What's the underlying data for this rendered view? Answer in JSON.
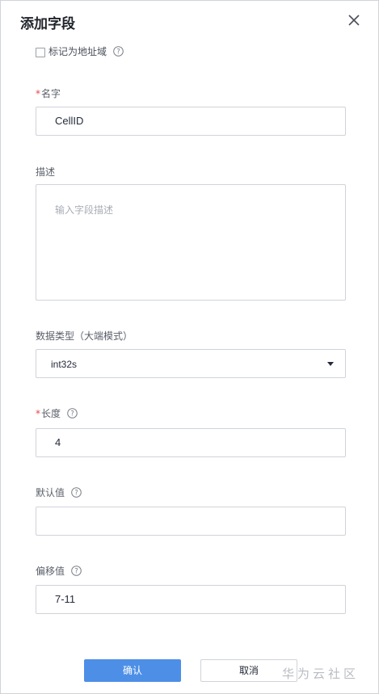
{
  "dialog": {
    "title": "添加字段",
    "close_icon": "close-icon"
  },
  "address_checkbox": {
    "label": "标记为地址域",
    "checked": false,
    "help_icon": "question-circle-icon"
  },
  "name_field": {
    "label": "名字",
    "required_mark": "*",
    "value": "CellID"
  },
  "description_field": {
    "label": "描述",
    "placeholder": "输入字段描述",
    "value": ""
  },
  "data_type_field": {
    "label": "数据类型（大端模式）",
    "value": "int32s",
    "caret_icon": "caret-down-icon"
  },
  "length_field": {
    "label": "长度",
    "required_mark": "*",
    "value": "4",
    "help_icon": "question-circle-icon"
  },
  "default_field": {
    "label": "默认值",
    "value": "",
    "help_icon": "question-circle-icon"
  },
  "offset_field": {
    "label": "偏移值",
    "value": "7-11",
    "help_icon": "question-circle-icon"
  },
  "footer": {
    "confirm_label": "确认",
    "cancel_label": "取消"
  },
  "watermark": {
    "text": "华为云社区"
  },
  "colors": {
    "primary": "#4d8fe6",
    "required": "#e5484d",
    "border": "#cfd3da"
  }
}
